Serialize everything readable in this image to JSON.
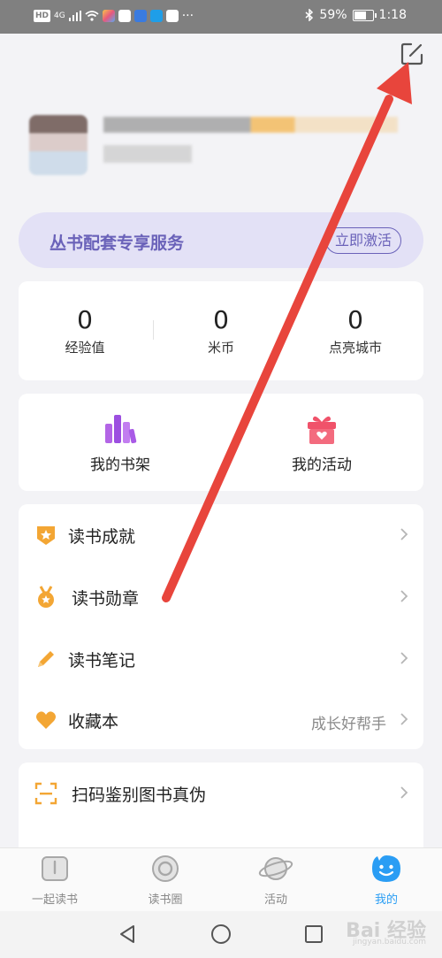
{
  "status_bar": {
    "left_labels": [
      "HD",
      "4G"
    ],
    "battery": "59%",
    "battery_level": 0.59,
    "time": "1:18",
    "more": "···"
  },
  "header": {
    "edit_icon": "edit-icon"
  },
  "service_banner": {
    "title": "丛书配套专享服务",
    "button": "立即激活"
  },
  "stats": [
    {
      "value": "0",
      "label": "经验值"
    },
    {
      "value": "0",
      "label": "米币"
    },
    {
      "value": "0",
      "label": "点亮城市"
    }
  ],
  "shortcuts": [
    {
      "label": "我的书架",
      "icon": "bookshelf-icon"
    },
    {
      "label": "我的活动",
      "icon": "gift-icon"
    }
  ],
  "menu": [
    {
      "label": "读书成就",
      "icon": "achievement-badge-icon",
      "right": ""
    },
    {
      "label": "读书勋章",
      "icon": "medal-icon",
      "right": ""
    },
    {
      "label": "读书笔记",
      "icon": "pencil-icon",
      "right": ""
    },
    {
      "label": "收藏本",
      "icon": "heart-icon",
      "right": "成长好帮手"
    }
  ],
  "menu2": [
    {
      "label": "扫码鉴别图书真伪",
      "icon": "scan-icon"
    }
  ],
  "bottom_nav": [
    {
      "label": "一起读书",
      "icon": "book-icon",
      "active": false
    },
    {
      "label": "读书圈",
      "icon": "circle-icon",
      "active": false
    },
    {
      "label": "活动",
      "icon": "planet-icon",
      "active": false
    },
    {
      "label": "我的",
      "icon": "smiley-icon",
      "active": true
    }
  ],
  "watermark": {
    "text": "Bai 经验",
    "sub": "jingyan.baidu.com"
  },
  "colors": {
    "accent": "#6a62b9",
    "active_tab": "#2a9df4",
    "arrow": "#e8453c",
    "status_bar": "#808080"
  }
}
